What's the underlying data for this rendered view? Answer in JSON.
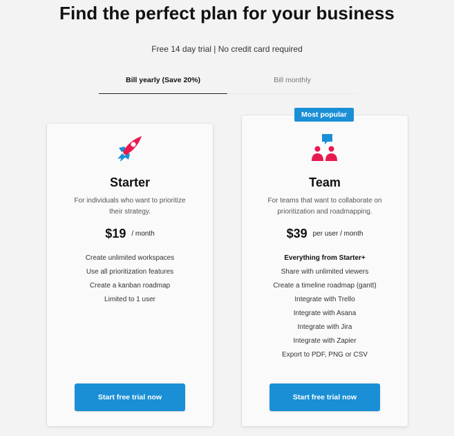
{
  "header": {
    "title": "Find the perfect plan for your business",
    "subtitle": "Free 14 day trial | No credit card required"
  },
  "billing_tabs": {
    "yearly": "Bill yearly (Save 20%)",
    "monthly": "Bill monthly",
    "selected": "yearly"
  },
  "colors": {
    "accent": "#1a8fd6",
    "icon_red": "#e8194f",
    "icon_blue": "#1a8fd6"
  },
  "plans": [
    {
      "icon": "rocket-icon",
      "name": "Starter",
      "description": "For individuals who want to prioritize their strategy.",
      "price": "$19",
      "period": "/ month",
      "features": [
        "Create unlimited workspaces",
        "Use all prioritization features",
        "Create a kanban roadmap",
        "Limited to 1 user"
      ],
      "cta": "Start free trial now"
    },
    {
      "badge": "Most popular",
      "icon": "team-chat-icon",
      "name": "Team",
      "description": "For teams that want to collaborate on prioritization and roadmapping.",
      "price": "$39",
      "period": "per user / month",
      "features_heading": "Everything from Starter+",
      "features": [
        "Share with unlimited viewers",
        "Create a timeline roadmap (gantt)",
        "Integrate with Trello",
        "Integrate with Asana",
        "Integrate with Jira",
        "Integrate with Zapier",
        "Export to PDF, PNG or CSV"
      ],
      "cta": "Start free trial now"
    }
  ]
}
